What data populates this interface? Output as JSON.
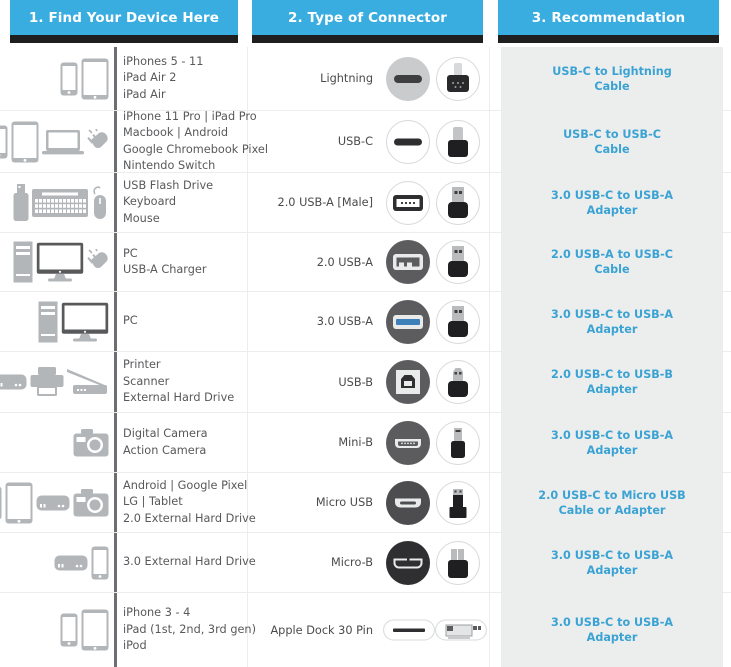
{
  "headers": [
    {
      "label": "1. Find Your Device Here"
    },
    {
      "label": "2. Type of Connector"
    },
    {
      "label": "3. Recommendation"
    }
  ],
  "colors": {
    "header_blue": "#3aade0",
    "header_underline": "#201f1f",
    "recommendation_text": "#3aa3d4",
    "recommendation_bg": "#eceded",
    "device_text": "#58595b",
    "connector_text": "#4a4a4c",
    "icon_gray": "#b3b6b9",
    "icon_dark": "#58595b"
  },
  "rows": [
    {
      "devices": [
        "iPhones 5 - 11",
        "iPad Air 2",
        "iPad Air"
      ],
      "device_icons": [
        "phone-icon",
        "tablet-icon"
      ],
      "connector": "Lightning",
      "connector_icons": [
        "lightning-port-icon",
        "lightning-plug-icon"
      ],
      "recommendation": [
        "USB-C to Lightning",
        "Cable"
      ]
    },
    {
      "devices": [
        "iPhone 11 Pro | iPad Pro",
        "Macbook | Android",
        "Google Chromebook Pixel",
        "Nintendo Switch"
      ],
      "device_icons": [
        "phone-icon",
        "tablet-icon",
        "laptop-icon",
        "plug-icon"
      ],
      "connector": "USB-C",
      "connector_icons": [
        "usb-c-port-icon",
        "usb-c-plug-icon"
      ],
      "recommendation": [
        "USB-C to USB-C",
        "Cable"
      ]
    },
    {
      "devices": [
        "USB Flash Drive",
        "Keyboard",
        "Mouse"
      ],
      "device_icons": [
        "flash-drive-icon",
        "keyboard-icon",
        "mouse-icon"
      ],
      "connector": "2.0 USB-A [Male]",
      "connector_icons": [
        "usb-a-male-port-icon",
        "usb-a-plug-icon"
      ],
      "recommendation": [
        "3.0 USB-C to USB-A",
        "Adapter"
      ]
    },
    {
      "devices": [
        "PC",
        "USB-A Charger"
      ],
      "device_icons": [
        "tower-icon",
        "monitor-icon",
        "plug-icon"
      ],
      "connector": "2.0 USB-A",
      "connector_icons": [
        "usb-a-20-port-icon",
        "usb-a-plug-icon"
      ],
      "recommendation": [
        "2.0 USB-A to USB-C",
        "Cable"
      ]
    },
    {
      "devices": [
        "PC"
      ],
      "device_icons": [
        "tower-icon",
        "monitor-icon"
      ],
      "connector": "3.0 USB-A",
      "connector_icons": [
        "usb-a-30-port-icon",
        "usb-a-plug-icon"
      ],
      "recommendation": [
        "3.0 USB-C to USB-A",
        "Adapter"
      ]
    },
    {
      "devices": [
        "Printer",
        "Scanner",
        "External Hard Drive"
      ],
      "device_icons": [
        "external-drive-icon",
        "printer-icon",
        "scanner-icon"
      ],
      "connector": "USB-B",
      "connector_icons": [
        "usb-b-port-icon",
        "usb-b-plug-icon"
      ],
      "recommendation": [
        "2.0 USB-C to USB-B",
        "Adapter"
      ]
    },
    {
      "devices": [
        "Digital Camera",
        "Action Camera"
      ],
      "device_icons": [
        "camera-icon"
      ],
      "connector": "Mini-B",
      "connector_icons": [
        "mini-b-port-icon",
        "mini-b-plug-icon"
      ],
      "recommendation": [
        "3.0 USB-C to USB-A",
        "Adapter"
      ]
    },
    {
      "devices": [
        "Android | Google Pixel",
        "LG | Tablet",
        "2.0 External Hard Drive"
      ],
      "device_icons": [
        "phone-icon",
        "tablet-icon",
        "external-drive-icon",
        "camera-icon"
      ],
      "connector": "Micro USB",
      "connector_icons": [
        "micro-usb-port-icon",
        "micro-usb-plug-icon"
      ],
      "recommendation": [
        "2.0 USB-C to Micro USB",
        "Cable or Adapter"
      ]
    },
    {
      "devices": [
        "3.0 External Hard Drive"
      ],
      "device_icons": [
        "external-drive-icon",
        "phone-icon"
      ],
      "connector": "Micro-B",
      "connector_icons": [
        "micro-b-port-icon",
        "micro-b-plug-icon"
      ],
      "recommendation": [
        "3.0 USB-C to USB-A",
        "Adapter"
      ]
    },
    {
      "devices": [
        "iPhone 3 - 4",
        "iPad (1st, 2nd, 3rd gen)",
        "iPod"
      ],
      "device_icons": [
        "phone-icon",
        "tablet-icon"
      ],
      "connector": "Apple Dock 30 Pin",
      "connector_icons": [
        "dock-30-port-icon",
        "dock-30-plug-icon"
      ],
      "recommendation": [
        "3.0 USB-C to USB-A",
        "Adapter"
      ]
    }
  ]
}
